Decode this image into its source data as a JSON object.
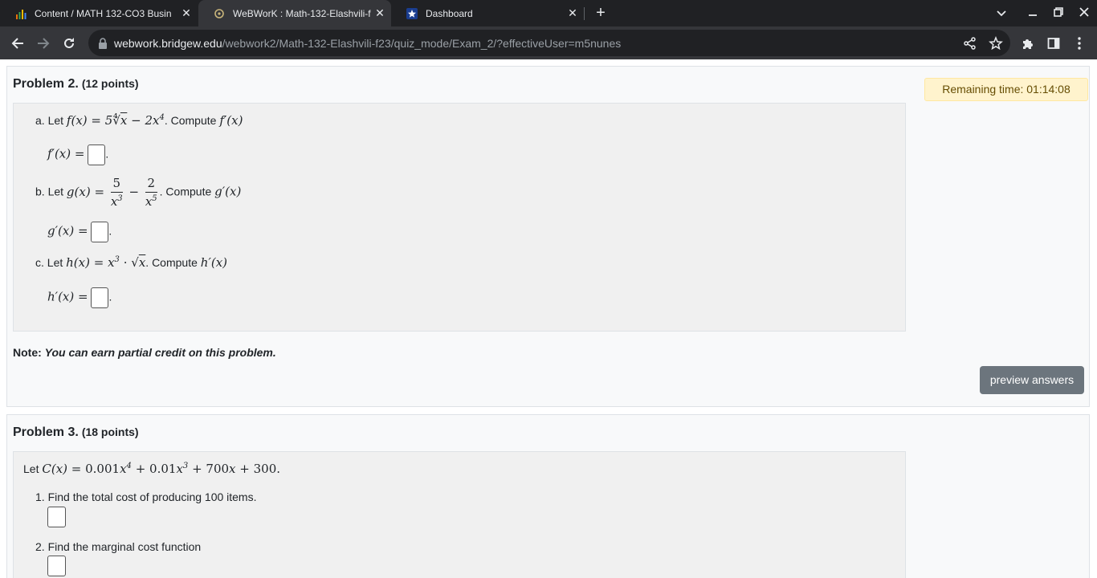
{
  "browser": {
    "tabs": [
      {
        "title": "Content / MATH 132-CO3 Busin",
        "icon": "bar-chart-favicon",
        "active": false
      },
      {
        "title": "WeBWorK : Math-132-Elashvili-f",
        "icon": "webwork-favicon",
        "active": true
      },
      {
        "title": "Dashboard",
        "icon": "star-favicon",
        "active": false
      }
    ],
    "url_domain": "webwork.bridgew.edu",
    "url_path": "/webwork2/Math-132-Elashvili-f23/quiz_mode/Exam_2/?effectiveUser=m5nunes"
  },
  "timer": {
    "text": "Remaining time: 01:14:08"
  },
  "problem2": {
    "title": "Problem 2.",
    "points": "(12 points)",
    "a_label": "a. Let",
    "a_compute": ". Compute",
    "b_label": "b. Let",
    "b_compute": ". Compute",
    "c_label": "c. Let",
    "c_compute": ". Compute",
    "note_label": "Note:",
    "note_text": "You can earn partial credit on this problem.",
    "preview_button": "preview answers"
  },
  "problem3": {
    "title": "Problem 3.",
    "points": "(18 points)",
    "intro_label": "Let",
    "q1": "1. Find the total cost of producing 100 items.",
    "q2": "2. Find the marginal cost function"
  }
}
